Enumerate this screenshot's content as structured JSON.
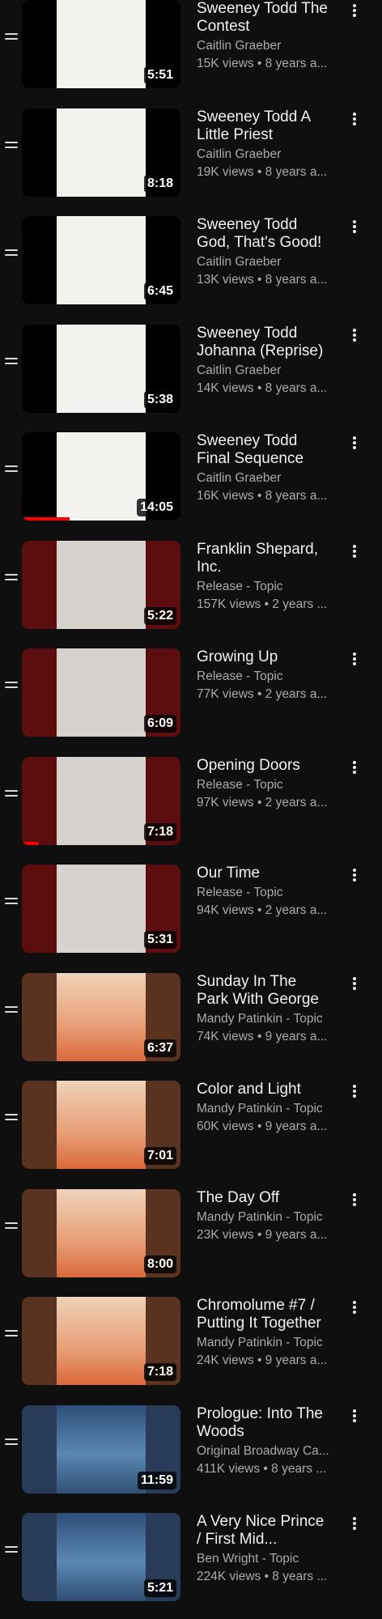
{
  "playlist": {
    "items": [
      {
        "title": "Sweeney Todd The Contest",
        "channel": "Caitlin Graeber",
        "stats": "15K views • 8 years a...",
        "duration": "5:51",
        "poster": "sweeney",
        "bg": "black",
        "progress": 0
      },
      {
        "title": "Sweeney Todd A Little Priest",
        "channel": "Caitlin Graeber",
        "stats": "19K views • 8 years a...",
        "duration": "8:18",
        "poster": "sweeney",
        "bg": "black",
        "progress": 0
      },
      {
        "title": "Sweeney Todd God, That's Good!",
        "channel": "Caitlin Graeber",
        "stats": "13K views • 8 years a...",
        "duration": "6:45",
        "poster": "sweeney",
        "bg": "black",
        "progress": 0
      },
      {
        "title": "Sweeney Todd Johanna (Reprise)",
        "channel": "Caitlin Graeber",
        "stats": "14K views • 8 years a...",
        "duration": "5:38",
        "poster": "sweeney",
        "bg": "black",
        "progress": 0
      },
      {
        "title": "Sweeney Todd Final Sequence",
        "channel": "Caitlin Graeber",
        "stats": "16K views • 8 years a...",
        "duration": "14:05",
        "poster": "sweeney",
        "bg": "black",
        "progress": 0.3
      },
      {
        "title": "Franklin Shepard, Inc.",
        "channel": "Release - Topic",
        "stats": "157K views • 2 years ...",
        "duration": "5:22",
        "poster": "merrily",
        "bg": "red",
        "progress": 0
      },
      {
        "title": "Growing Up",
        "channel": "Release - Topic",
        "stats": "77K views • 2 years a...",
        "duration": "6:09",
        "poster": "merrily",
        "bg": "red",
        "progress": 0
      },
      {
        "title": "Opening Doors",
        "channel": "Release - Topic",
        "stats": "97K views • 2 years a...",
        "duration": "7:18",
        "poster": "merrily",
        "bg": "red",
        "progress": 0.1
      },
      {
        "title": "Our Time",
        "channel": "Release - Topic",
        "stats": "94K views • 2 years a...",
        "duration": "5:31",
        "poster": "merrily",
        "bg": "red",
        "progress": 0
      },
      {
        "title": "Sunday In The Park With George",
        "channel": "Mandy Patinkin - Topic",
        "stats": "74K views • 9 years a...",
        "duration": "6:37",
        "poster": "sunday",
        "bg": "brown",
        "progress": 0
      },
      {
        "title": "Color and Light",
        "channel": "Mandy Patinkin - Topic",
        "stats": "60K views • 9 years a...",
        "duration": "7:01",
        "poster": "sunday",
        "bg": "brown",
        "progress": 0
      },
      {
        "title": "The Day Off",
        "channel": "Mandy Patinkin - Topic",
        "stats": "23K views • 9 years a...",
        "duration": "8:00",
        "poster": "sunday",
        "bg": "brown",
        "progress": 0
      },
      {
        "title": "Chromolume #7 / Putting It Together",
        "channel": "Mandy Patinkin - Topic",
        "stats": "24K views • 9 years a...",
        "duration": "7:18",
        "poster": "sunday",
        "bg": "brown",
        "progress": 0
      },
      {
        "title": "Prologue: Into The Woods",
        "channel": "Original Broadway Ca...",
        "stats": "411K views • 8 years ...",
        "duration": "11:59",
        "poster": "woods",
        "bg": "navy",
        "progress": 0
      },
      {
        "title": "A Very Nice Prince / First Mid...",
        "channel": "Ben Wright - Topic",
        "stats": "224K views • 8 years ...",
        "duration": "5:21",
        "poster": "woods",
        "bg": "navy",
        "progress": 0
      }
    ]
  },
  "icons": {
    "handle": "drag-handle-icon",
    "more": "more-vert-icon"
  },
  "colors": {
    "background": "#0f0f0f",
    "progress": "#ff0000",
    "secondary_text": "#aaaaaa"
  }
}
